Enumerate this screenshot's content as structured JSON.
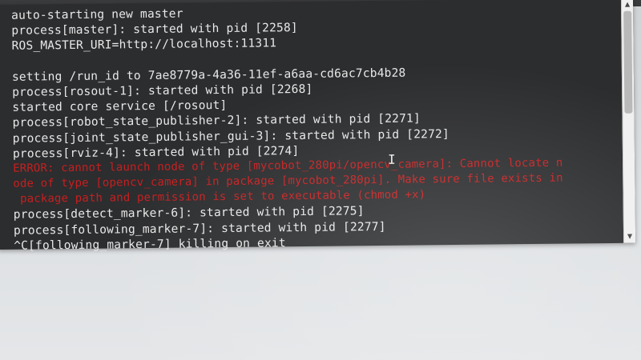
{
  "terminal": {
    "lines": [
      {
        "text": "auto-starting new master",
        "type": "normal"
      },
      {
        "text": "process[master]: started with pid [2258]",
        "type": "normal"
      },
      {
        "text": "ROS_MASTER_URI=http://localhost:11311",
        "type": "normal"
      },
      {
        "text": "",
        "type": "blank"
      },
      {
        "text": "setting /run_id to 7ae8779a-4a36-11ef-a6aa-cd6ac7cb4b28",
        "type": "normal"
      },
      {
        "text": "process[rosout-1]: started with pid [2268]",
        "type": "normal"
      },
      {
        "text": "started core service [/rosout]",
        "type": "normal"
      },
      {
        "text": "process[robot_state_publisher-2]: started with pid [2271]",
        "type": "normal"
      },
      {
        "text": "process[joint_state_publisher_gui-3]: started with pid [2272]",
        "type": "normal"
      },
      {
        "text": "process[rviz-4]: started with pid [2274]",
        "type": "normal"
      },
      {
        "text": "ERROR: cannot launch node of type [mycobot_280pi/opencv_camera]: Cannot locate n",
        "type": "error"
      },
      {
        "text": "ode of type [opencv_camera] in package [mycobot_280pi]. Make sure file exists in",
        "type": "error"
      },
      {
        "text": " package path and permission is set to executable (chmod +x)",
        "type": "error"
      },
      {
        "text": "process[detect_marker-6]: started with pid [2275]",
        "type": "normal"
      },
      {
        "text": "process[following_marker-7]: started with pid [2277]",
        "type": "normal"
      },
      {
        "text": "^C[following_marker-7] killing on exit",
        "type": "normal"
      }
    ],
    "text_cursor_glyph": "I"
  },
  "scrollbar": {
    "up_arrow": "▲",
    "down_arrow": "▼"
  },
  "colors": {
    "terminal_bg": "#2c2d2f",
    "text": "#e8e8e8",
    "error": "#c71f1f"
  }
}
